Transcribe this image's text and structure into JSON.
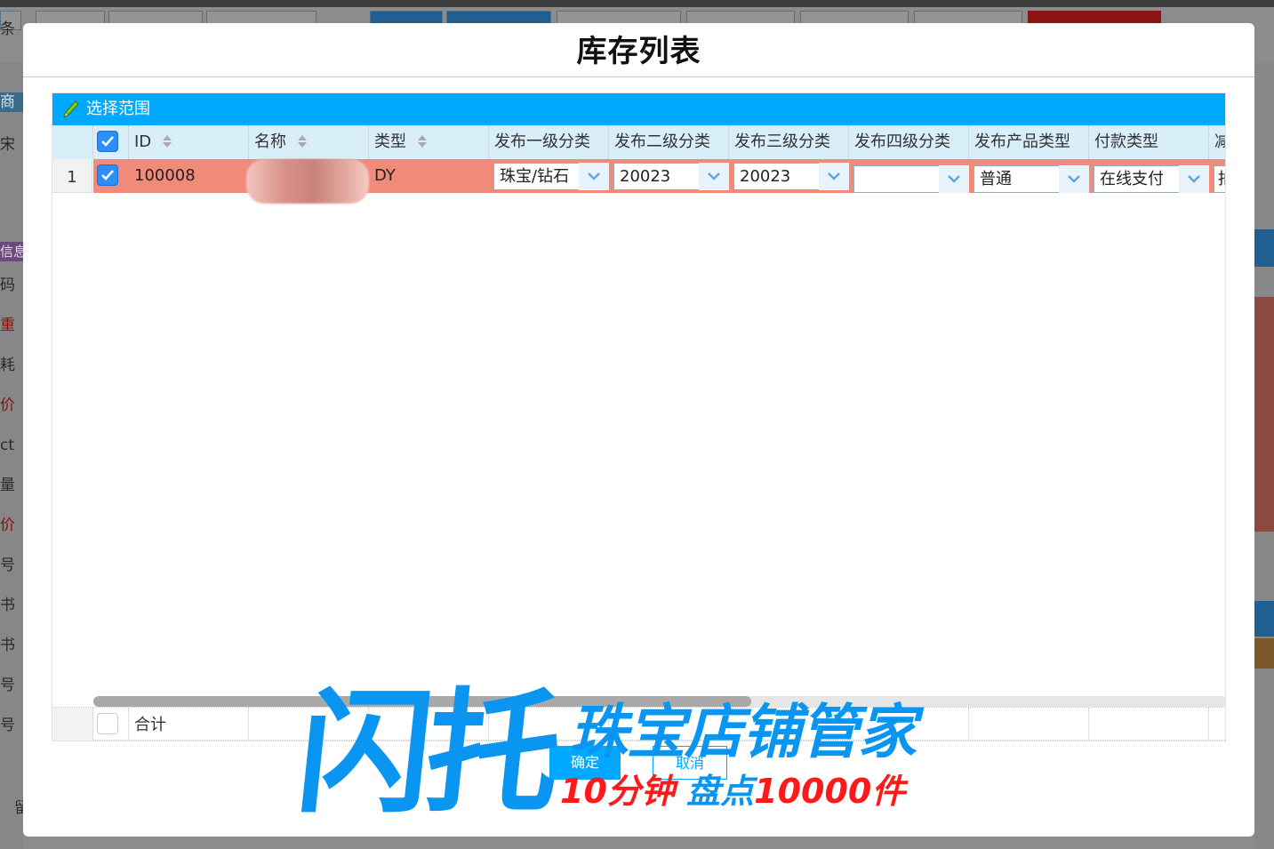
{
  "background": {
    "left_labels": [
      "条",
      "商",
      "宋",
      "信息",
      "码",
      "重",
      "耗",
      "价",
      "ct",
      "量",
      "价",
      "号",
      "书",
      "书",
      "号",
      "号",
      "留"
    ]
  },
  "modal": {
    "title": "库存列表"
  },
  "toolbar": {
    "select_range_label": "选择范围"
  },
  "grid": {
    "columns": [
      {
        "key": "check",
        "label": ""
      },
      {
        "key": "id",
        "label": "ID",
        "sortable": true
      },
      {
        "key": "name",
        "label": "名称",
        "sortable": true
      },
      {
        "key": "type",
        "label": "类型",
        "sortable": true
      },
      {
        "key": "cat1",
        "label": "发布一级分类"
      },
      {
        "key": "cat2",
        "label": "发布二级分类"
      },
      {
        "key": "cat3",
        "label": "发布三级分类"
      },
      {
        "key": "cat4",
        "label": "发布四级分类"
      },
      {
        "key": "product_type",
        "label": "发布产品类型"
      },
      {
        "key": "payment_type",
        "label": "付款类型"
      },
      {
        "key": "reduce",
        "label": "减"
      }
    ],
    "rows": [
      {
        "rownum": "1",
        "checked": true,
        "id": "100008",
        "type": "DY",
        "cat1": "珠宝/钻石",
        "cat2": "20023",
        "cat3": "20023",
        "cat4": "",
        "product_type": "普通",
        "payment_type": "在线支付",
        "reduce": "拍"
      }
    ],
    "footer": {
      "total_label": "合计"
    }
  },
  "buttons": {
    "ok_label": "确定",
    "cancel_label": "取消"
  },
  "watermark": {
    "brand": "闪托",
    "product": "珠宝店铺管家",
    "slogan_part1": "10分钟",
    "slogan_part2": "盘点",
    "slogan_part3": "10000件"
  },
  "colors": {
    "accent": "#00a8ff",
    "header_bg": "#d8eef9",
    "selected_row": "#f08a7a",
    "checkbox": "#2c8ef8"
  }
}
